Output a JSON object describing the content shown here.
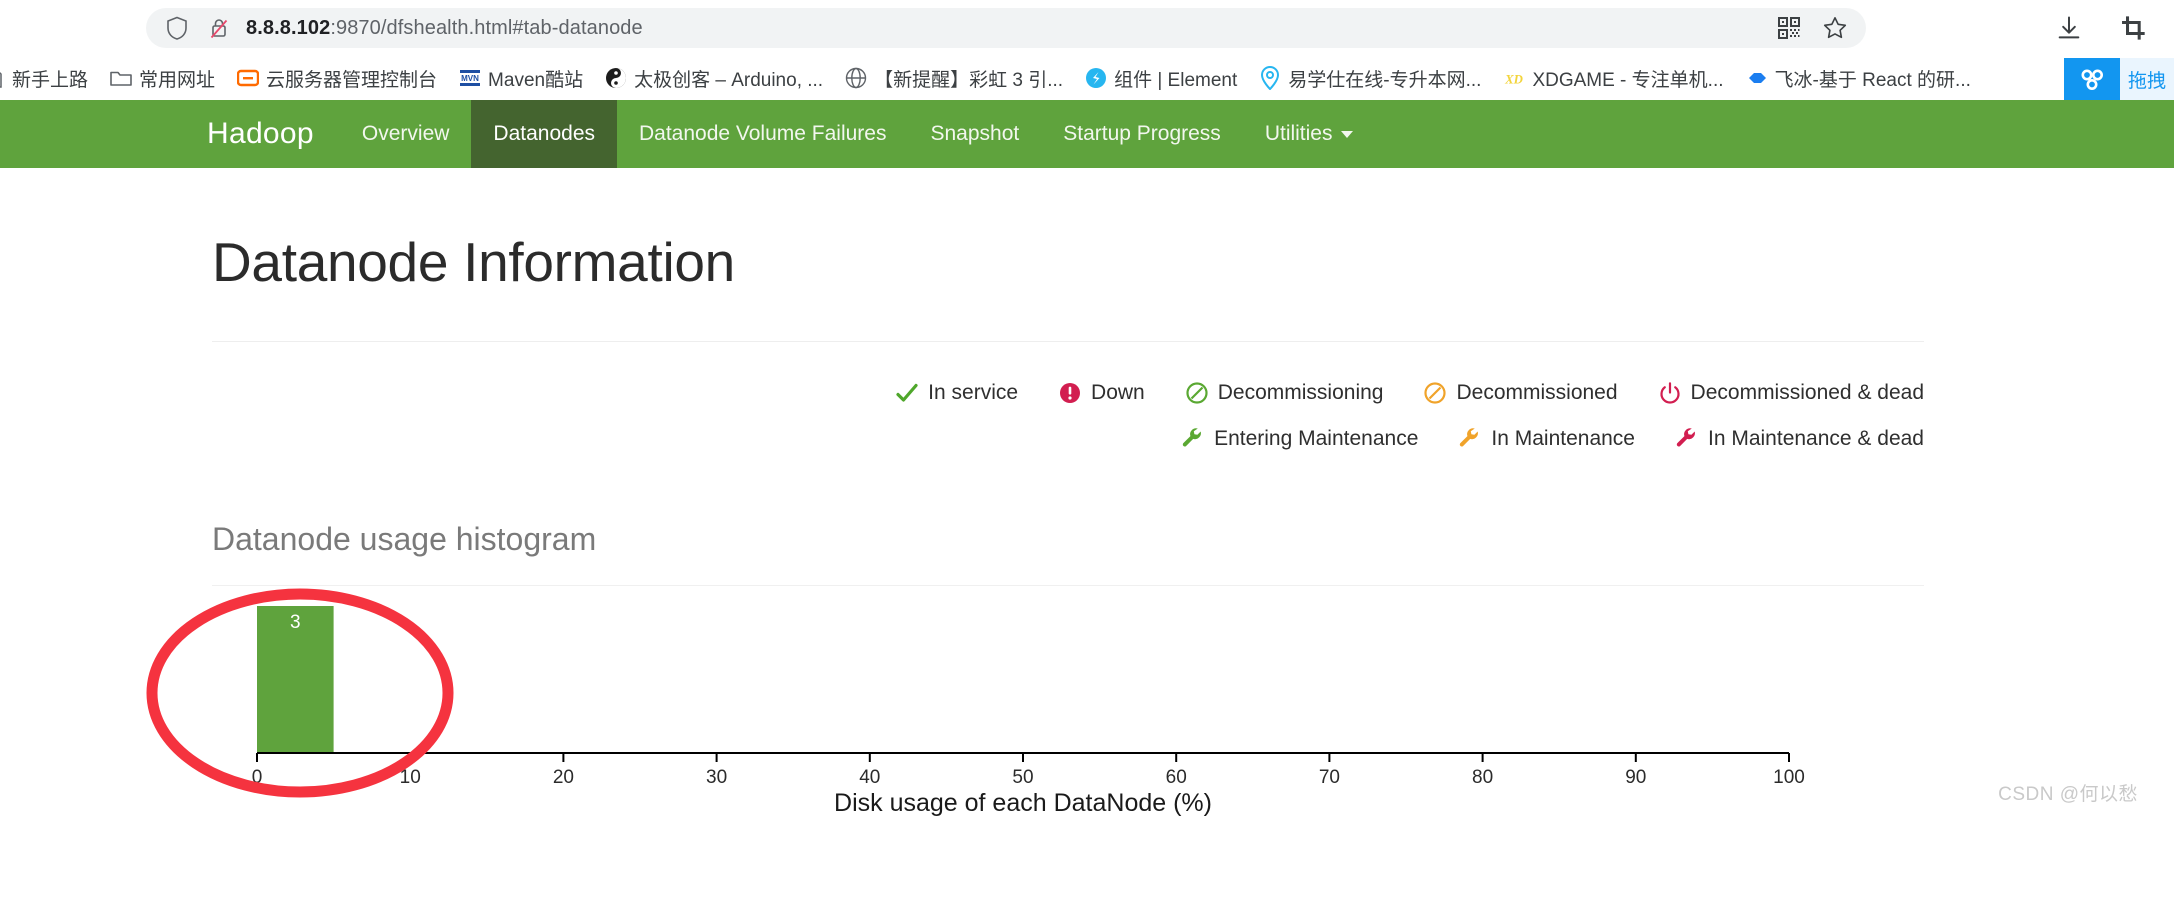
{
  "browser": {
    "shield_icon": "shield-icon",
    "security_icon": "insecure-lock-icon",
    "url_host": "8.8.8.102",
    "url_rest": ":9870/dfshealth.html#tab-datanode",
    "qr_icon": "qr-code-icon",
    "bookmark_star_icon": "star-icon",
    "download_icon": "download-icon",
    "capture_icon": "screenshot-crop-icon"
  },
  "bookmarks": {
    "items": [
      {
        "label": "新手上路",
        "icon": "page-icon"
      },
      {
        "label": "常用网址",
        "icon": "folder-icon"
      },
      {
        "label": "云服务器管理控制台",
        "icon": "aliyun-icon"
      },
      {
        "label": "Maven酷站",
        "icon": "maven-icon"
      },
      {
        "label": "太极创客 – Arduino, ...",
        "icon": "taiji-icon"
      },
      {
        "label": "【新提醒】彩虹 3 引...",
        "icon": "globe-icon"
      },
      {
        "label": "组件 | Element",
        "icon": "element-icon"
      },
      {
        "label": "易学仕在线-专升本网...",
        "icon": "location-icon"
      },
      {
        "label": "XDGAME - 专注单机...",
        "icon": "xdgame-icon"
      },
      {
        "label": "飞冰-基于 React 的研...",
        "icon": "ice-icon"
      }
    ],
    "netdisk": {
      "label": "拖拽",
      "icon": "baidu-netdisk-icon"
    }
  },
  "navbar": {
    "brand": "Hadoop",
    "items": [
      {
        "label": "Overview",
        "active": false
      },
      {
        "label": "Datanodes",
        "active": true
      },
      {
        "label": "Datanode Volume Failures",
        "active": false
      },
      {
        "label": "Snapshot",
        "active": false
      },
      {
        "label": "Startup Progress",
        "active": false
      },
      {
        "label": "Utilities",
        "active": false,
        "caret": true
      }
    ],
    "bg_color": "#5fa33d",
    "active_color": "#44642f"
  },
  "main": {
    "page_title": "Datanode Information",
    "legend_rows": [
      [
        {
          "label": "In service",
          "icon": "check-icon",
          "color": "#4fa72b"
        },
        {
          "label": "Down",
          "icon": "exclamation-circle-icon",
          "color": "#d21e50"
        },
        {
          "label": "Decommissioning",
          "icon": "ban-circle-icon",
          "color": "#5aa832"
        },
        {
          "label": "Decommissioned",
          "icon": "ban-circle-icon",
          "color": "#f0a32a"
        },
        {
          "label": "Decommissioned & dead",
          "icon": "power-off-icon",
          "color": "#d21e50"
        }
      ],
      [
        {
          "label": "Entering Maintenance",
          "icon": "wrench-icon",
          "color": "#5aa832"
        },
        {
          "label": "In Maintenance",
          "icon": "wrench-icon",
          "color": "#f0a32a"
        },
        {
          "label": "In Maintenance & dead",
          "icon": "wrench-icon",
          "color": "#d21e50"
        }
      ]
    ],
    "histogram_title": "Datanode usage histogram"
  },
  "chart_data": {
    "type": "bar",
    "title": "Datanode usage histogram",
    "xlabel": "Disk usage of each DataNode (%)",
    "ylabel": "",
    "xlim": [
      0,
      100
    ],
    "ylim": [
      0,
      3
    ],
    "xticks": [
      0,
      10,
      20,
      30,
      40,
      50,
      60,
      70,
      80,
      90,
      100
    ],
    "xtick_labels": [
      "0",
      "10",
      "20",
      "30",
      "40",
      "50",
      "60",
      "70",
      "80",
      "90",
      "100"
    ],
    "grid": false,
    "bar_color": "#5fa33d",
    "bars": [
      {
        "x_start": 0,
        "x_end": 5,
        "value": 3,
        "label": "3"
      }
    ]
  },
  "annotation": {
    "shape": "ellipse",
    "color": "#f5333f"
  },
  "watermark": "CSDN @何以愁"
}
